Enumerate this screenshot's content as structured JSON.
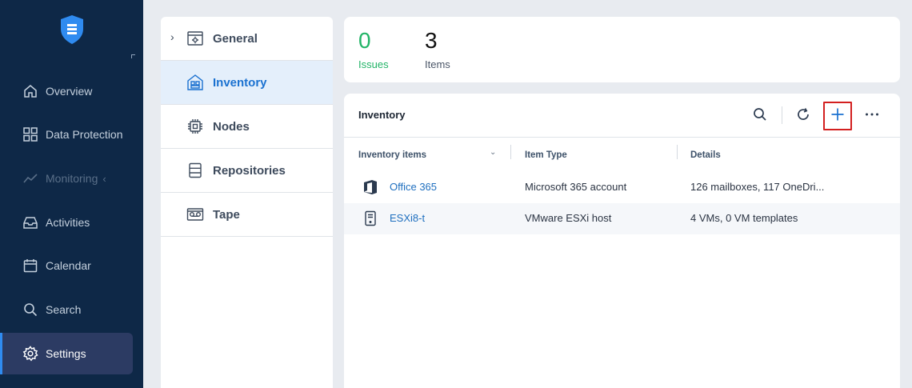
{
  "nav": {
    "items": [
      {
        "label": "Overview",
        "icon": "home-icon"
      },
      {
        "label": "Data Protection",
        "icon": "grid-icon"
      },
      {
        "label": "Monitoring",
        "icon": "chart-line-icon"
      },
      {
        "label": "Activities",
        "icon": "inbox-icon"
      },
      {
        "label": "Calendar",
        "icon": "calendar-icon"
      },
      {
        "label": "Search",
        "icon": "search-icon"
      },
      {
        "label": "Settings",
        "icon": "gear-icon"
      }
    ],
    "active": "Settings"
  },
  "submenu": {
    "items": [
      {
        "label": "General",
        "icon": "settings-panel-icon"
      },
      {
        "label": "Inventory",
        "icon": "inventory-icon"
      },
      {
        "label": "Nodes",
        "icon": "chip-icon"
      },
      {
        "label": "Repositories",
        "icon": "database-icon"
      },
      {
        "label": "Tape",
        "icon": "tape-icon"
      }
    ],
    "active": "Inventory"
  },
  "stats": {
    "issues": {
      "value": "0",
      "label": "Issues"
    },
    "items": {
      "value": "3",
      "label": "Items"
    }
  },
  "inventory": {
    "title": "Inventory",
    "columns": [
      "Inventory items",
      "Item Type",
      "Details"
    ],
    "rows": [
      {
        "name": "Office 365",
        "type": "Microsoft 365 account",
        "details": "126 mailboxes, 117 OneDri...",
        "icon": "office-icon"
      },
      {
        "name": "ESXi8-t",
        "type": "VMware ESXi host",
        "details": "4 VMs, 0 VM templates",
        "icon": "server-icon"
      }
    ]
  },
  "colors": {
    "nav_bg": "#0e2847",
    "accent": "#1a71d0",
    "issues_green": "#22b467",
    "highlight_red": "#d32020"
  }
}
